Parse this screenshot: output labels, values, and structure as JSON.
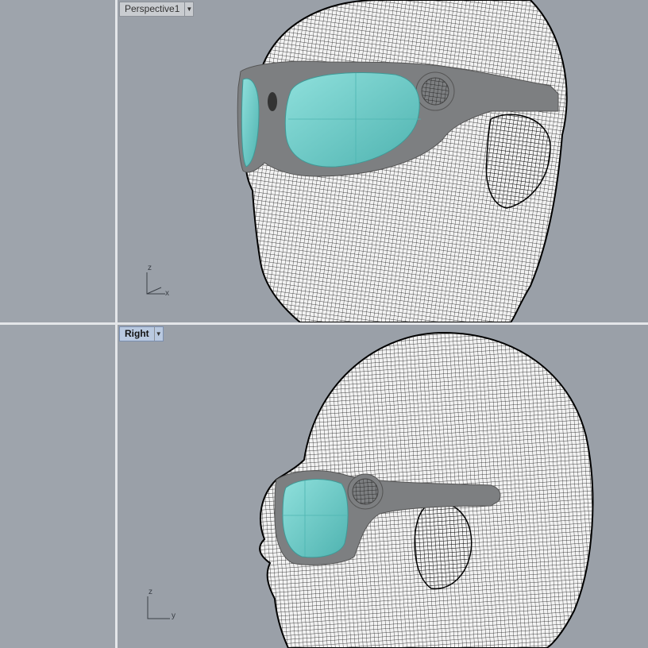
{
  "viewports": {
    "top": {
      "title": "Perspective1",
      "menu_icon": "chevron-down-icon",
      "axes": {
        "vertical": "z",
        "horizontal": "x"
      }
    },
    "bottom": {
      "title": "Right",
      "menu_icon": "chevron-down-icon",
      "axes": {
        "vertical": "z",
        "horizontal": "y"
      }
    }
  },
  "colors": {
    "viewport_bg": "#9aa0a8",
    "separator": "#e4e6e9",
    "wireframe": "#111111",
    "goggle_frame": "#7d7f81",
    "lens": "#6cc9c6",
    "active_tab": "#b9c9e0"
  }
}
